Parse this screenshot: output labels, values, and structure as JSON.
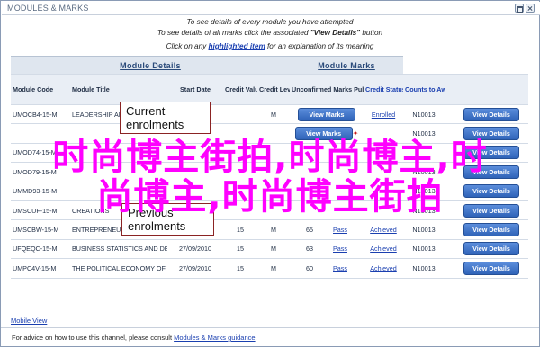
{
  "window": {
    "title": "MODULES & MARKS"
  },
  "intro": {
    "line1": "To see details of every module you have attempted",
    "line2_pre": "To see details of all marks click the associated ",
    "line2_bold": "\"View Details\"",
    "line2_post": " button",
    "line3_pre": "Click on any ",
    "line3_link": "highlighted item",
    "line3_post": " for an explanation of its meaning"
  },
  "groups": {
    "details": "Module Details",
    "marks": "Module Marks"
  },
  "headers": {
    "code": "Module Code",
    "title": "Module Title",
    "date": "Start Date",
    "value": "Credit Value",
    "level": "Credit Level",
    "unconfirmed": "Unconfirmed Marks Published",
    "status": "Credit Status",
    "counts": "Counts to Award"
  },
  "rows": [
    {
      "code": "UMOCB4-15-M",
      "title": "LEADERSHIP AN",
      "date": "",
      "value": "",
      "level": "M",
      "mark": "",
      "action": "View Marks",
      "status": "Enrolled",
      "counts": "N10013",
      "details": "View Details"
    },
    {
      "code": "",
      "title": "",
      "date": "",
      "value": "",
      "level": "",
      "mark": "",
      "action": "View Marks",
      "status": "",
      "counts": "N10013",
      "details": "View Details"
    },
    {
      "code": "UMOD74-15-M",
      "title": "",
      "date": "",
      "value": "",
      "level": "",
      "mark": "",
      "action": "",
      "status": "",
      "counts": "",
      "details": "View Details"
    },
    {
      "code": "UMOD79-15-M",
      "title": "",
      "date": "",
      "value": "",
      "level": "",
      "mark": "",
      "action": "",
      "status": "",
      "counts": "N10013",
      "details": "View Details"
    },
    {
      "code": "UMMD93-15-M",
      "title": "",
      "date": "",
      "value": "",
      "level": "",
      "mark": "",
      "action": "",
      "status": "",
      "counts": "N10013",
      "details": "View Details"
    },
    {
      "code": "UMSCUF-15-M",
      "title": "CREATIONS",
      "date": "",
      "value": "",
      "level": "",
      "mark": "",
      "action": "",
      "status": "",
      "counts": "N10013",
      "details": "View Details"
    },
    {
      "code": "UMSCBW-15-M",
      "title": "ENTREPRENEURSHIP AND NEW BUSINESS",
      "date": "27/09/2011",
      "value": "15",
      "level": "M",
      "mark": "65",
      "action": "Pass",
      "status": "Achieved",
      "counts": "N10013",
      "details": "View Details"
    },
    {
      "code": "UFQEQC-15-M",
      "title": "BUSINESS STATISTICS AND DECISION MAKING",
      "date": "27/09/2010",
      "value": "15",
      "level": "M",
      "mark": "63",
      "action": "Pass",
      "status": "Achieved",
      "counts": "N10013",
      "details": "View Details"
    },
    {
      "code": "UMPC4V-15-M",
      "title": "THE POLITICAL ECONOMY OF WORK (FOREIGN)",
      "date": "27/09/2010",
      "value": "15",
      "level": "M",
      "mark": "60",
      "action": "Pass",
      "status": "Achieved",
      "counts": "N10013",
      "details": "View Details"
    }
  ],
  "callouts": {
    "current": "Current enrolments",
    "previous": "Previous enrolments"
  },
  "watermark": {
    "line1": "时尚博主街拍,时尚博主,时",
    "line2": "尚博主,时尚博主街拍"
  },
  "footer": {
    "mobile_link": "Mobile View",
    "advice_pre": "For advice on how to use this channel, please consult ",
    "advice_link": "Modules & Marks guidance",
    "advice_post": "."
  }
}
